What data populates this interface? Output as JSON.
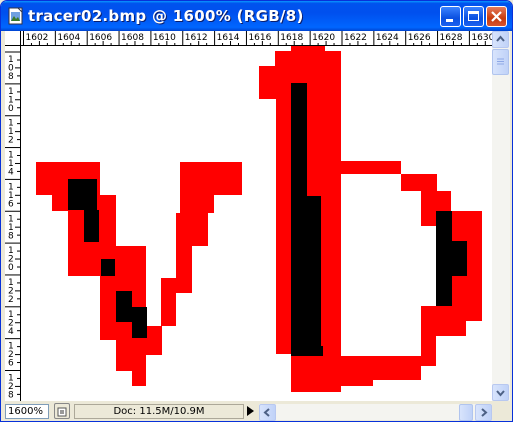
{
  "window": {
    "title": "tracer02.bmp @ 1600% (RGB/8)"
  },
  "ruler": {
    "top_labels": [
      "1602",
      "1604",
      "1606",
      "1608",
      "1610",
      "1612",
      "1614",
      "1616",
      "1618",
      "1620",
      "1622",
      "1624",
      "1626",
      "1628",
      "1630"
    ],
    "left_labels": [
      "108",
      "110",
      "112",
      "114",
      "116",
      "118",
      "120",
      "122",
      "124",
      "126",
      "128"
    ]
  },
  "status": {
    "zoom": "1600%",
    "doc_info": "Doc: 11.5M/10.9M"
  },
  "colors": {
    "outline": "#ff0000",
    "fill": "#000000",
    "background": "#ffffff"
  }
}
